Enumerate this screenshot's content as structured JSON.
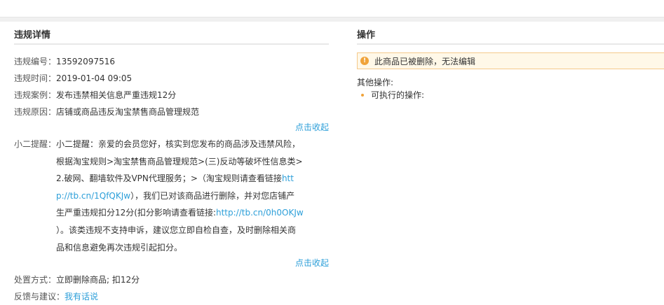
{
  "colors": {
    "link": "#2d9fd9",
    "notice_border": "#f5c98a",
    "notice_bg": "#fff8e8",
    "warn_icon": "#f0a33a"
  },
  "violation": {
    "title": "违规详情",
    "fields": [
      {
        "label": "违规编号：",
        "value": "13592097516"
      },
      {
        "label": "违规时间：",
        "value": "2019-01-04 09:05"
      },
      {
        "label": "违规案例：",
        "value": "发布违禁相关信息严重违规12分"
      },
      {
        "label": "违规原因：",
        "value": "店铺或商品违反淘宝禁售商品管理规范"
      }
    ],
    "collapse_label": "点击收起",
    "reminder": {
      "label": "小二提醒：",
      "line1": "小二提醒：亲爱的会员您好，核实到您发布的商品涉及违禁风险，",
      "line2": "根据淘宝规则>淘宝禁售商品管理规范>(三)反动等破坏性信息类>",
      "line3_text": "2.破网、翻墙软件及VPN代理服务；>（淘宝规则请查看链接",
      "line3_link": "htt",
      "line4_link": "p://tb.cn/1QfQKJw",
      "line4_text": "），我们已对该商品进行删除，并对您店铺产",
      "line5_text": "生严重违规扣分12分(扣分影响请查看链接:",
      "line5_link": "http://tb.cn/0h0OKJw",
      "line6": "）。该类违规不支持申诉，建议您立即自检自查，及时删除相关商",
      "line7": "品和信息避免再次违规引起扣分。"
    },
    "collapse_label_2": "点击收起",
    "handling": {
      "label": "处置方式：",
      "value": "立即删除商品; 扣12分"
    },
    "feedback": {
      "label": "反馈与建议：",
      "link": "我有话说"
    }
  },
  "operations": {
    "title": "操作",
    "notice_icon": "warning-icon",
    "notice_text": "此商品已被删除，无法编辑",
    "other_label": "其他操作:",
    "executable_label": "可执行的操作:"
  }
}
